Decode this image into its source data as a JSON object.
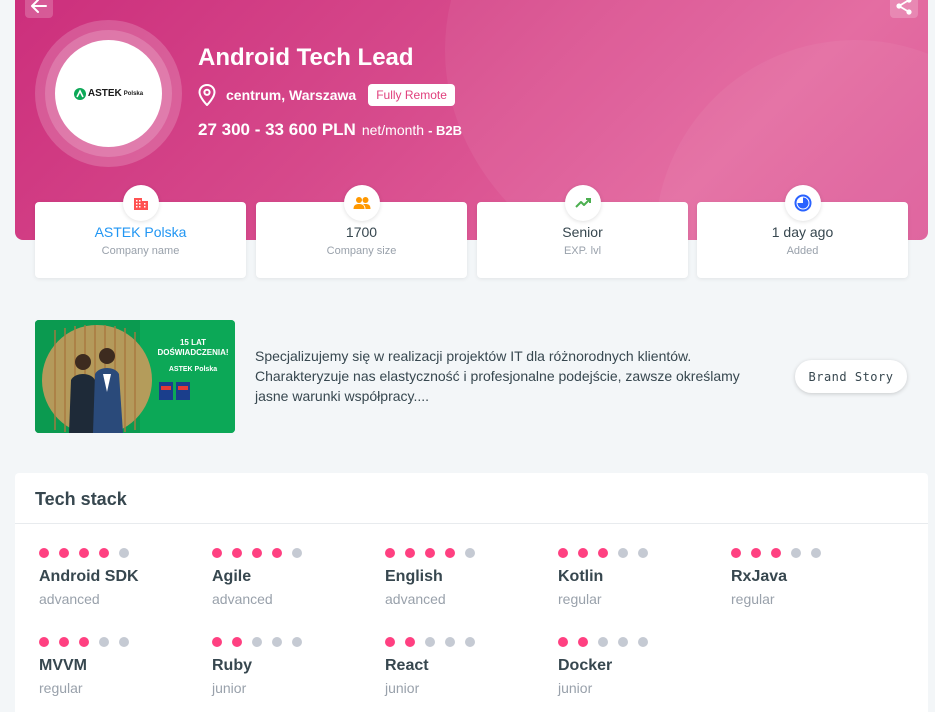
{
  "header": {
    "job_title": "Android Tech Lead",
    "location": "centrum, Warszawa",
    "remote_badge": "Fully Remote",
    "salary": "27 300 - 33 600 PLN",
    "salary_unit": "net/month",
    "salary_type": "- B2B",
    "logo_text": "ASTEK",
    "logo_subtext": "Polska"
  },
  "cards": [
    {
      "value": "ASTEK Polska",
      "label": "Company name",
      "icon": "building-icon",
      "color": "#ff5252"
    },
    {
      "value": "1700",
      "label": "Company size",
      "icon": "people-icon",
      "color": "#ff9800"
    },
    {
      "value": "Senior",
      "label": "EXP. lvl",
      "icon": "trend-up-icon",
      "color": "#4caf50"
    },
    {
      "value": "1 day ago",
      "label": "Added",
      "icon": "clock-icon",
      "color": "#2962ff"
    }
  ],
  "brand": {
    "description": "Specjalizujemy się w realizacji projektów IT dla różnorodnych klientów. Charakteryzuje nas elastyczność i profesjonalne podejście, zawsze określamy jasne warunki współpracy....",
    "button_label": "Brand Story",
    "image_headline": "15 LAT\nDOŚWIADCZENIA!",
    "image_logo": "ASTEK Polska"
  },
  "tech_stack": {
    "title": "Tech stack",
    "skills": [
      {
        "name": "Android SDK",
        "level": "advanced",
        "dots": 4
      },
      {
        "name": "Agile",
        "level": "advanced",
        "dots": 4
      },
      {
        "name": "English",
        "level": "advanced",
        "dots": 4
      },
      {
        "name": "Kotlin",
        "level": "regular",
        "dots": 3
      },
      {
        "name": "RxJava",
        "level": "regular",
        "dots": 3
      },
      {
        "name": "MVVM",
        "level": "regular",
        "dots": 3
      },
      {
        "name": "Ruby",
        "level": "junior",
        "dots": 2
      },
      {
        "name": "React",
        "level": "junior",
        "dots": 2
      },
      {
        "name": "Docker",
        "level": "junior",
        "dots": 2
      }
    ]
  }
}
